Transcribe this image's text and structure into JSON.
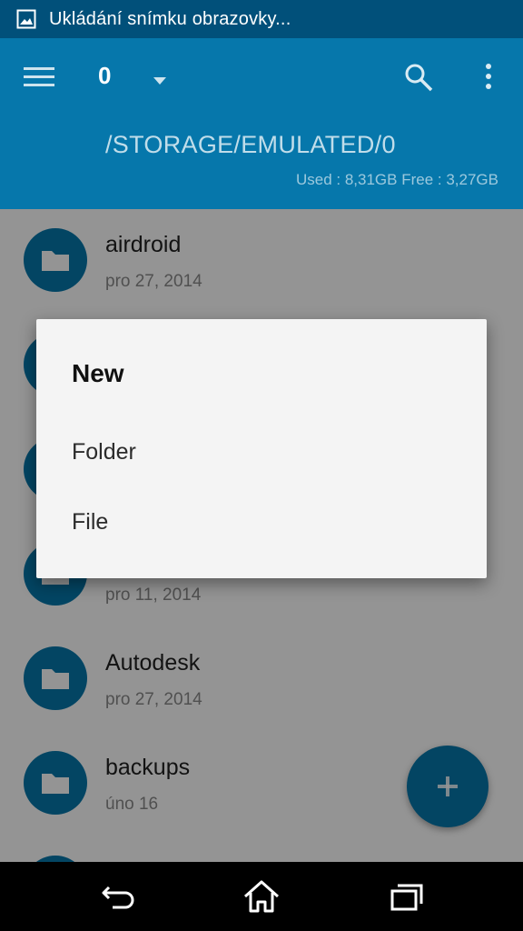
{
  "status_bar": {
    "text": "Ukládání snímku obrazovky..."
  },
  "toolbar": {
    "tab_count": "0",
    "path": "/STORAGE/EMULATED/0",
    "storage_info": "Used : 8,31GB Free : 3,27GB"
  },
  "files": [
    {
      "name": "airdroid",
      "date": "pro 27, 2014"
    },
    {
      "name": "",
      "date": ""
    },
    {
      "name": "",
      "date": ""
    },
    {
      "name": "",
      "date": "pro 11, 2014"
    },
    {
      "name": "Autodesk",
      "date": "pro 27, 2014"
    },
    {
      "name": "backups",
      "date": "úno 16"
    }
  ],
  "dialog": {
    "title": "New",
    "options": [
      "Folder",
      "File"
    ]
  },
  "colors": {
    "primary": "#0677ab",
    "status_bar": "#01507a",
    "dialog_bg": "#f4f4f4"
  },
  "icons": [
    "image-icon",
    "menu-icon",
    "dropdown-icon",
    "search-icon",
    "more-vert-icon",
    "folder-icon",
    "add-icon",
    "back-icon",
    "home-icon",
    "recents-icon"
  ]
}
